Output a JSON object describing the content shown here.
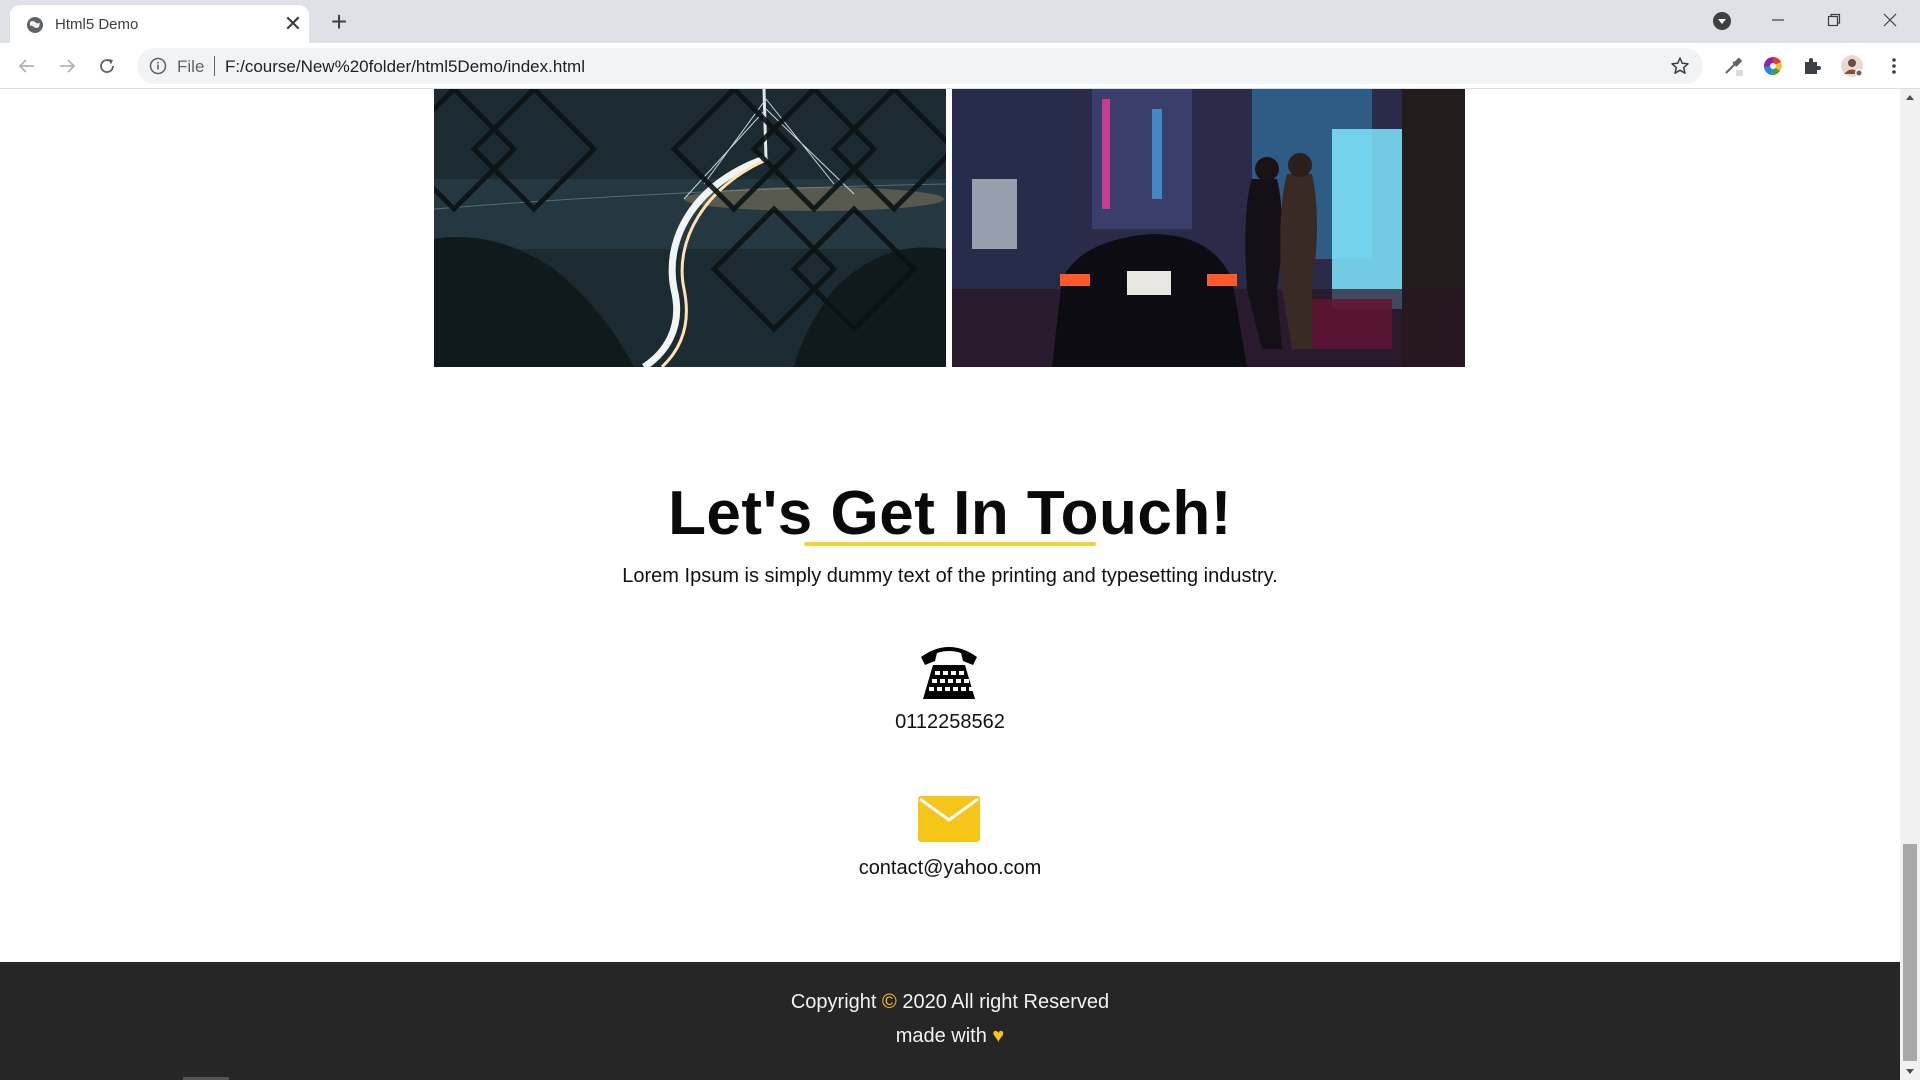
{
  "browser": {
    "tab_title": "Html5 Demo",
    "tab_close": "✕",
    "new_tab": "+",
    "scheme_label": "File",
    "url": "F:/course/New%20folder/html5Demo/index.html",
    "window_controls": {
      "minimize": "minimize-icon",
      "restore": "restore-icon",
      "close": "close-icon"
    }
  },
  "gallery": {
    "images": [
      {
        "name": "night-bridge-photo"
      },
      {
        "name": "city-street-taxi-photo"
      }
    ]
  },
  "contact": {
    "title": "Let's Get In Touch!",
    "description": "Lorem Ipsum is simply dummy text of the printing and typesetting industry.",
    "phone": "0112258562",
    "email": "contact@yahoo.com",
    "accent_color": "#f5c518"
  },
  "footer": {
    "copyright_prefix": "Copyright",
    "copyright_symbol": "©",
    "copyright_suffix": "2020 All right Reserved",
    "made_with": "made with",
    "heart": "♥",
    "background": "#262626"
  }
}
